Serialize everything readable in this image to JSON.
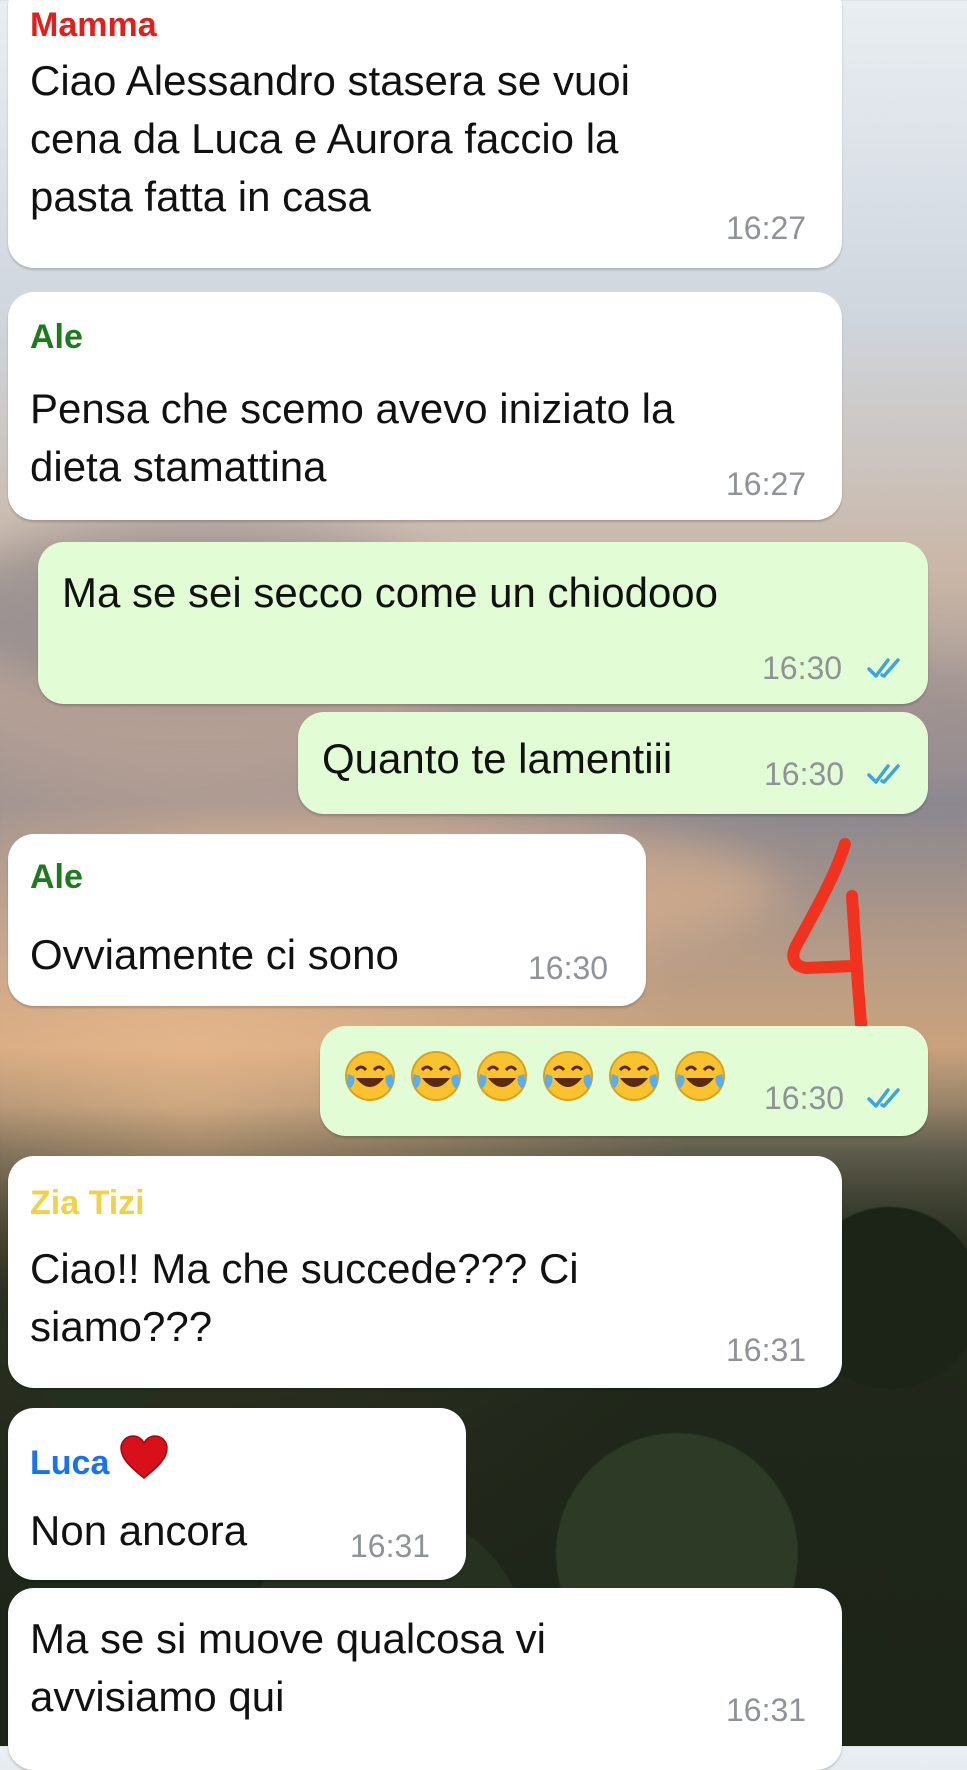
{
  "messages": [
    {
      "sender": "Mamma",
      "text": "Ciao Alessandro stasera se vuoi\ncena da Luca e Aurora faccio la\npasta fatta in casa",
      "time": "16:27"
    },
    {
      "sender": "Ale",
      "text": "Pensa che scemo avevo iniziato la\ndieta stamattina",
      "time": "16:27"
    },
    {
      "text": "Ma se sei secco come un chiodooo",
      "time": "16:30",
      "status": "read"
    },
    {
      "text": "Quanto te lamentiii",
      "time": "16:30",
      "status": "read"
    },
    {
      "sender": "Ale",
      "text": "Ovviamente ci sono",
      "time": "16:30"
    },
    {
      "emojis": [
        "face-with-tears-of-joy",
        "face-with-tears-of-joy",
        "face-with-tears-of-joy",
        "face-with-tears-of-joy",
        "face-with-tears-of-joy",
        "face-with-tears-of-joy"
      ],
      "time": "16:30",
      "status": "read"
    },
    {
      "sender": "Zia Tizi",
      "text": "Ciao!! Ma che succede??? Ci\nsiamo???",
      "time": "16:31"
    },
    {
      "sender": "Luca",
      "sender_emoji": "red-heart",
      "text": "Non ancora",
      "time": "16:31"
    },
    {
      "text": "Ma se si muove qualcosa vi\navvisiamo qui",
      "time": "16:31"
    }
  ],
  "annotation": {
    "text": "4",
    "color": "#f0321e"
  },
  "colors": {
    "incoming_bubble": "#ffffff",
    "outgoing_bubble": "#e2fdd5",
    "read_ticks": "#3fa3e0",
    "sender_mamma": "#e0201c",
    "sender_ale": "#1f7a1f",
    "sender_zia": "#f0d24a",
    "sender_luca": "#1a73e8"
  }
}
